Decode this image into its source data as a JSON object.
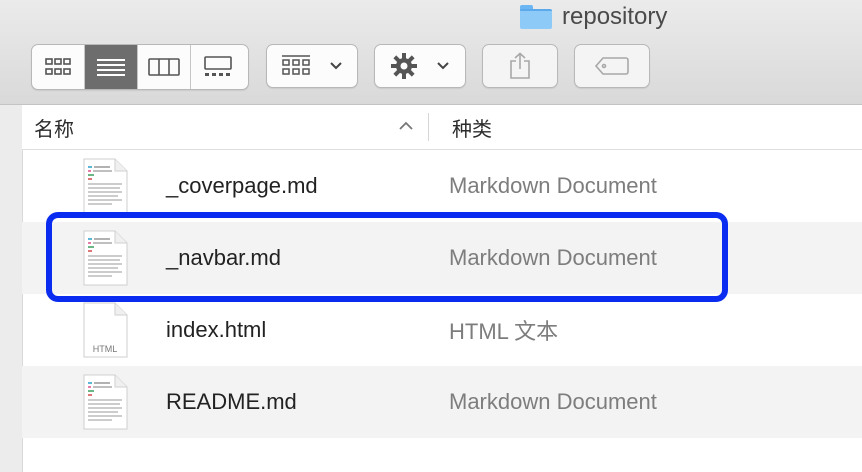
{
  "window": {
    "title": "repository"
  },
  "toolbar": {
    "view_modes": [
      "icon-view",
      "list-view",
      "column-view",
      "gallery-view"
    ],
    "active_view": "list-view",
    "group_menu_icon": "group-grid-icon",
    "action_menu_icon": "gear-icon",
    "share_icon": "share-icon",
    "tag_icon": "tag-icon"
  },
  "columns": {
    "name": "名称",
    "kind": "种类",
    "sort": "ascending"
  },
  "files": [
    {
      "name": "_coverpage.md",
      "kind": "Markdown Document",
      "icon": "markdown-doc-icon"
    },
    {
      "name": "_navbar.md",
      "kind": "Markdown Document",
      "icon": "markdown-doc-icon",
      "highlighted": true
    },
    {
      "name": "index.html",
      "kind": "HTML 文本",
      "icon": "html-doc-icon",
      "icon_label": "HTML"
    },
    {
      "name": "README.md",
      "kind": "Markdown Document",
      "icon": "markdown-doc-icon"
    }
  ],
  "colors": {
    "highlight": "#0a2cf0",
    "active_segment": "#6d6d6d",
    "folder": "#8ecaf8"
  }
}
